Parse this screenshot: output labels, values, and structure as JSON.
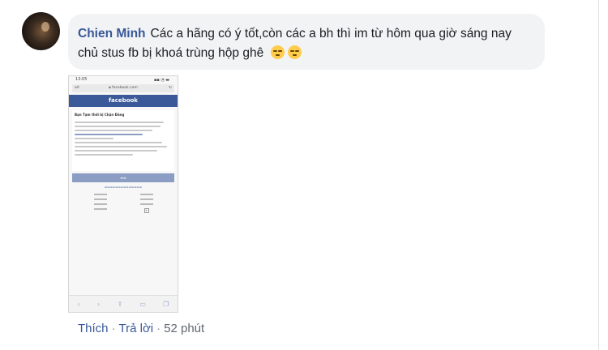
{
  "comment": {
    "author": "Chien Minh",
    "text": "Các a hãng có ý tốt,còn các a bh thì im từ hôm qua giờ sáng nay chủ stus fb bị khoá trùng hộp ghê",
    "emojis": [
      "relieved-face",
      "relieved-face"
    ]
  },
  "attachment": {
    "status_time": "13:05",
    "url": "facebook.com",
    "url_aa": "aA",
    "brand": "facebook",
    "card_title": "Bạn Tạm thời bị Chặn Đăng"
  },
  "actions": {
    "like": "Thích",
    "reply": "Trả lời",
    "separator": "·",
    "time": "52 phút"
  },
  "colors": {
    "link": "#385898",
    "bubble": "#f2f3f5",
    "fb_blue": "#3b5998"
  }
}
